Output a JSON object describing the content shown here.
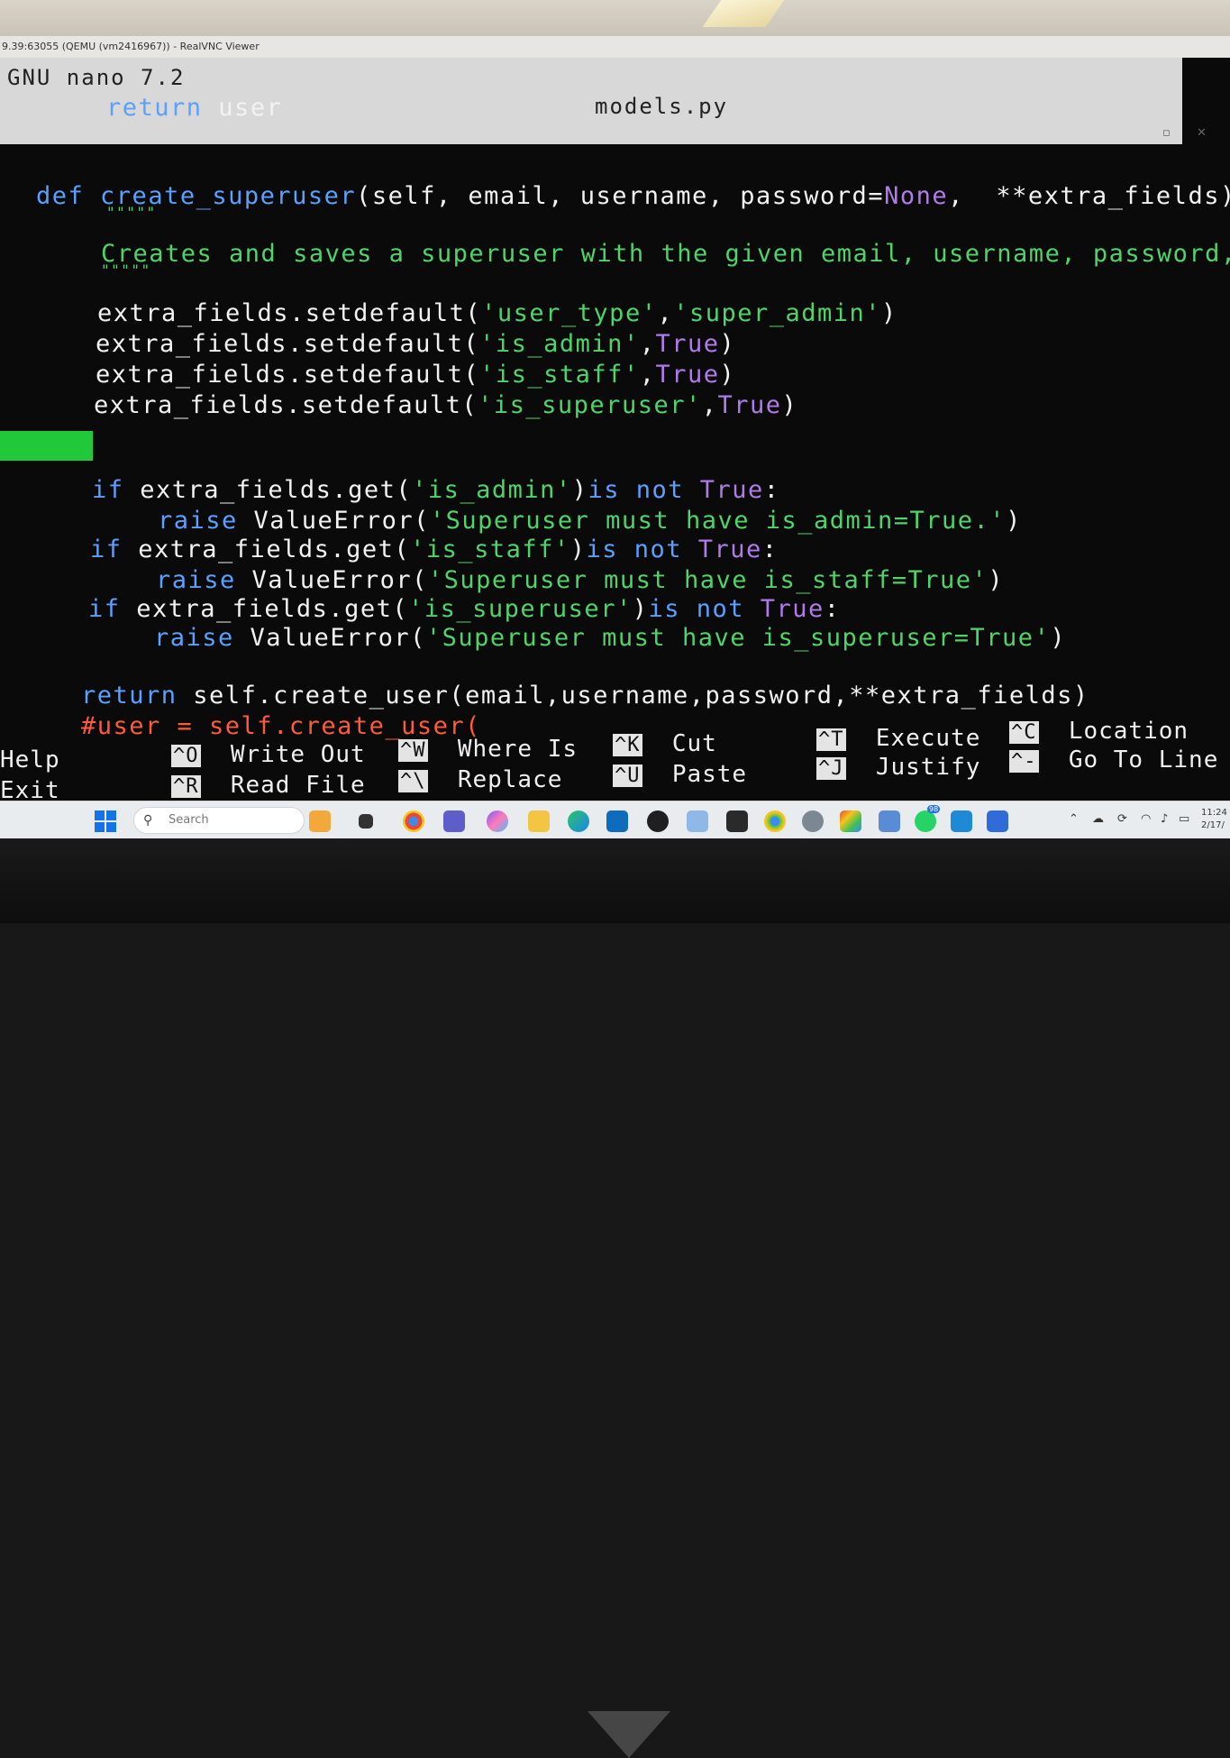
{
  "window": {
    "vnc_title": "9.39:63055 (QEMU (vm2416967)) - RealVNC Viewer"
  },
  "nano": {
    "version": "GNU nano 7.2",
    "filename": "models.py"
  },
  "code": {
    "l1": {
      "kw": "return",
      "rest": " user"
    },
    "l2": {
      "kw": "def",
      "fn": "create_superuser",
      "args": "(self, email, username, password=",
      "none": "None",
      "tail": ",  **extra_fields):"
    },
    "l3": {
      "doc": "\"\"\"\"\""
    },
    "l4": {
      "doc": "Creates and saves a superuser with the given email, username, password,"
    },
    "l5": {
      "doc": "\"\"\"\"\""
    },
    "l6": {
      "a": "extra_fields.setdefault(",
      "s1": "'user_type'",
      "c": ",",
      "s2": "'super_admin'",
      "b": ")"
    },
    "l7": {
      "a": "extra_fields.setdefault(",
      "s1": "'is_admin'",
      "c": ",",
      "t": "True",
      "b": ")"
    },
    "l8": {
      "a": "extra_fields.setdefault(",
      "s1": "'is_staff'",
      "c": ",",
      "t": "True",
      "b": ")"
    },
    "l9": {
      "a": "extra_fields.setdefault(",
      "s1": "'is_superuser'",
      "c": ",",
      "t": "True",
      "b": ")"
    },
    "l10": {
      "kw": "if",
      "a": " extra_fields.get(",
      "s": "'is_admin'",
      "b": ")",
      "kw2": "is not",
      "t": " True",
      "c": ":"
    },
    "l11": {
      "kw": "raise",
      "a": " ValueError(",
      "s": "'Superuser must have is_admin=True.'",
      "b": ")"
    },
    "l12": {
      "kw": "if",
      "a": " extra_fields.get(",
      "s": "'is_staff'",
      "b": ")",
      "kw2": "is not",
      "t": " True",
      "c": ":"
    },
    "l13": {
      "kw": "raise",
      "a": " ValueError(",
      "s": "'Superuser must have is_staff=True'",
      "b": ")"
    },
    "l14": {
      "kw": "if",
      "a": " extra_fields.get(",
      "s": "'is_superuser'",
      "b": ")",
      "kw2": "is not",
      "t": " True",
      "c": ":"
    },
    "l15": {
      "kw": "raise",
      "a": " ValueError(",
      "s": "'Superuser must have is_superuser=True'",
      "b": ")"
    },
    "l16": {
      "kw": "return",
      "rest": " self.create_user(email,username,password,**extra_fields)"
    },
    "l17": {
      "cmt": "#user = self.create_user("
    }
  },
  "shortcuts": [
    {
      "key1": "",
      "label1": "Help",
      "key2": "",
      "label2": "Exit"
    },
    {
      "key1": "^O",
      "label1": "Write Out",
      "key2": "^R",
      "label2": "Read File"
    },
    {
      "key1": "^W",
      "label1": "Where Is",
      "key2": "^\\",
      "label2": "Replace"
    },
    {
      "key1": "^K",
      "label1": "Cut",
      "key2": "^U",
      "label2": "Paste"
    },
    {
      "key1": "^T",
      "label1": "Execute",
      "key2": "^J",
      "label2": "Justify"
    },
    {
      "key1": "^C",
      "label1": "Location",
      "key2": "^-",
      "label2": "Go To Line"
    }
  ],
  "taskbar": {
    "search_placeholder": "Search",
    "badge": "98",
    "time": "11:24",
    "date": "2/17/"
  },
  "colors": {
    "keyword": "#5aa0ff",
    "string": "#4fd46a",
    "constant": "#b07be8",
    "comment": "#ff5a3c",
    "marker": "#21c93a"
  }
}
